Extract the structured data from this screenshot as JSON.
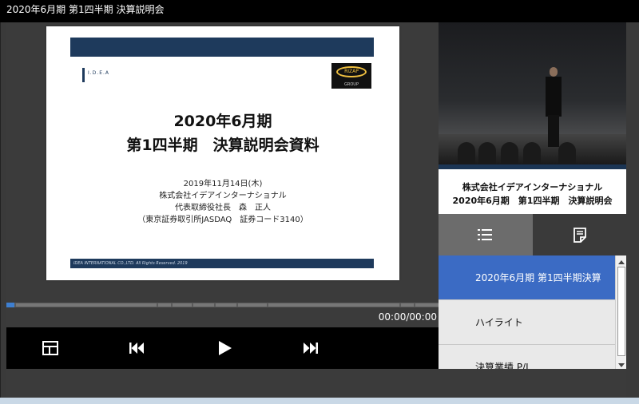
{
  "window": {
    "title": "2020年6月期 第1四半期 決算説明会"
  },
  "slide": {
    "logo_left": "I.D.E.A",
    "logo_right": "RIZAP",
    "logo_right_sub": "GROUP",
    "title_line1": "2020年6月期",
    "title_line2": "第1四半期　決算説明会資料",
    "date": "2019年11月14日(木)",
    "company": "株式会社イデアインターナショナル",
    "presenter": "代表取締役社長　森　正人",
    "exchange": "（東京証券取引所JASDAQ　証券コード3140）",
    "footer": "IDEA INTERNATIONAL CO.,LTD. All Rights Reserved. 2019"
  },
  "player": {
    "time_display": "00:00/00:00",
    "progress": 0.0
  },
  "camera": {
    "caption_line1": "株式会社イデアインターナショナル",
    "caption_line2": "2020年6月期　第1四半期　決算説明会"
  },
  "icons": {
    "layout": "layout-icon",
    "prev": "skip-back-icon",
    "play": "play-icon",
    "next": "skip-forward-icon",
    "list": "list-icon",
    "notes": "notes-icon"
  },
  "chapters": [
    {
      "label": "2020年6月期 第1四半期決算",
      "active": true
    },
    {
      "label": "ハイライト",
      "active": false
    },
    {
      "label": "決算業績 P/L",
      "active": false
    }
  ],
  "colors": {
    "accent": "#3b6bc4",
    "slide_navy": "#1e3a5c"
  }
}
